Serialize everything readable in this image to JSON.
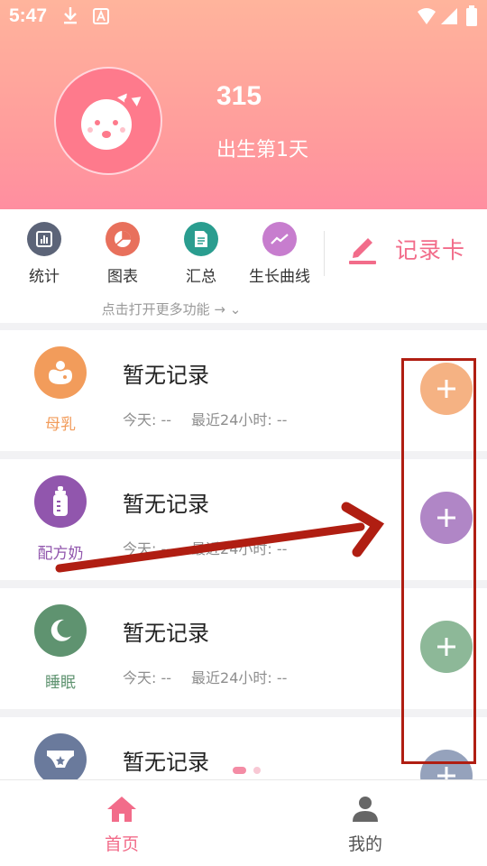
{
  "status_bar": {
    "time": "5:47"
  },
  "profile": {
    "name": "315",
    "age": "出生第1天"
  },
  "toolbar": {
    "items": [
      {
        "label": "统计",
        "icon": "stats-icon",
        "color": "#5c6478"
      },
      {
        "label": "图表",
        "icon": "pie-chart-icon",
        "color": "#e8705c"
      },
      {
        "label": "汇总",
        "icon": "summary-icon",
        "color": "#2a9d8f"
      },
      {
        "label": "生长曲线",
        "icon": "growth-curve-icon",
        "color": "#c77dce"
      }
    ],
    "record_card": "记录卡",
    "more_functions": "点击打开更多功能 → ⌄"
  },
  "records": [
    {
      "category": "母乳",
      "icon": "breastfeeding-icon",
      "color": "#f29c5b",
      "btn_color": "#f5b283",
      "title": "暂无记录",
      "today": "今天: --",
      "last24": "最近24小时: --"
    },
    {
      "category": "配方奶",
      "icon": "baby-bottle-icon",
      "color": "#9156ad",
      "btn_color": "#b086c6",
      "title": "暂无记录",
      "today": "今天: --",
      "last24": "最近24小时: --"
    },
    {
      "category": "睡眠",
      "icon": "moon-icon",
      "color": "#5f9370",
      "btn_color": "#8db898",
      "title": "暂无记录",
      "today": "今天: --",
      "last24": "最近24小时: --"
    },
    {
      "category": "",
      "icon": "diaper-icon",
      "color": "#6a7a9c",
      "btn_color": "#95a2bc",
      "title": "暂无记录",
      "today": "",
      "last24": ""
    }
  ],
  "bottom_nav": {
    "items": [
      {
        "label": "首页",
        "icon": "home-icon",
        "active": true
      },
      {
        "label": "我的",
        "icon": "profile-icon",
        "active": false
      }
    ]
  },
  "colors": {
    "accent_pink": "#f26c8a",
    "header_top": "#ffb49c",
    "header_bottom": "#ff8ea0",
    "annotation_red": "#b01e12"
  }
}
